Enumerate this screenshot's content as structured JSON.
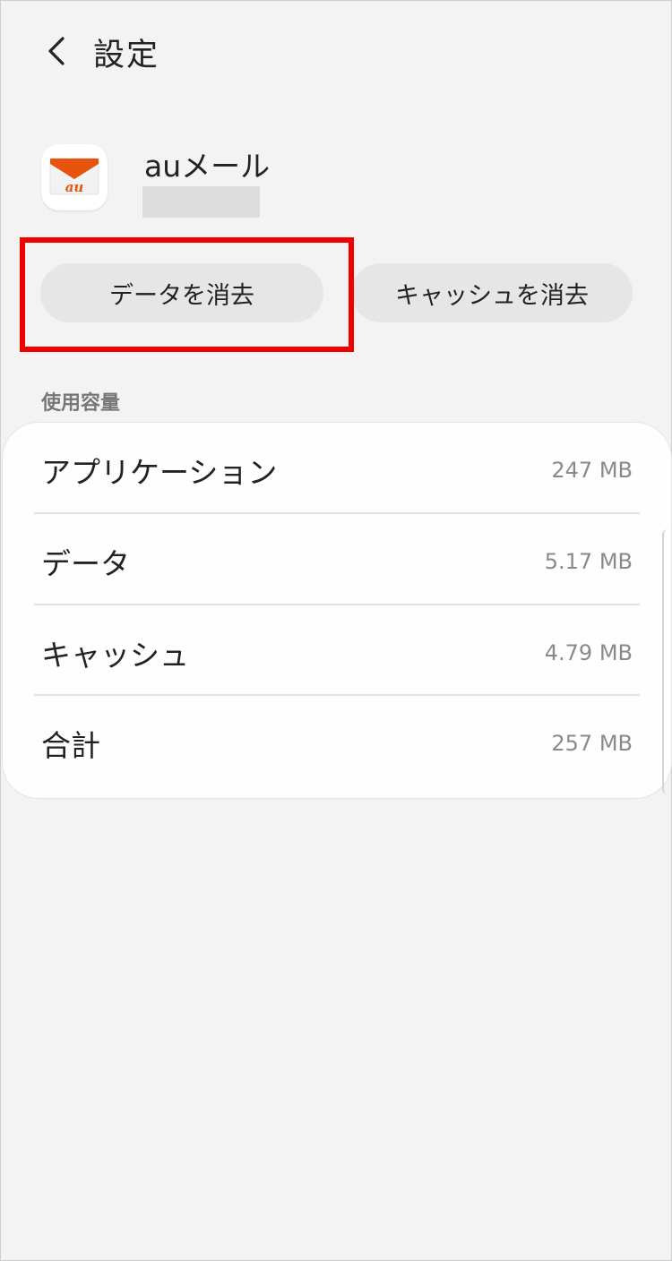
{
  "header": {
    "back_icon": "chevron-left-icon",
    "title": "設定"
  },
  "app": {
    "icon": "au-mail-envelope-icon",
    "icon_text": "au",
    "icon_colors": {
      "flap": "#e8520f",
      "body": "#f2f2f2",
      "text": "#e8520f"
    },
    "name": "auメール"
  },
  "actions": {
    "clear_data_label": "データを消去",
    "clear_cache_label": "キャッシュを消去",
    "highlight_color": "#f00000"
  },
  "storage": {
    "section_label": "使用容量",
    "rows": [
      {
        "label": "アプリケーション",
        "value": "247 MB"
      },
      {
        "label": "データ",
        "value": "5.17 MB"
      },
      {
        "label": "キャッシュ",
        "value": "4.79 MB"
      },
      {
        "label": "合計",
        "value": "257 MB"
      }
    ]
  }
}
